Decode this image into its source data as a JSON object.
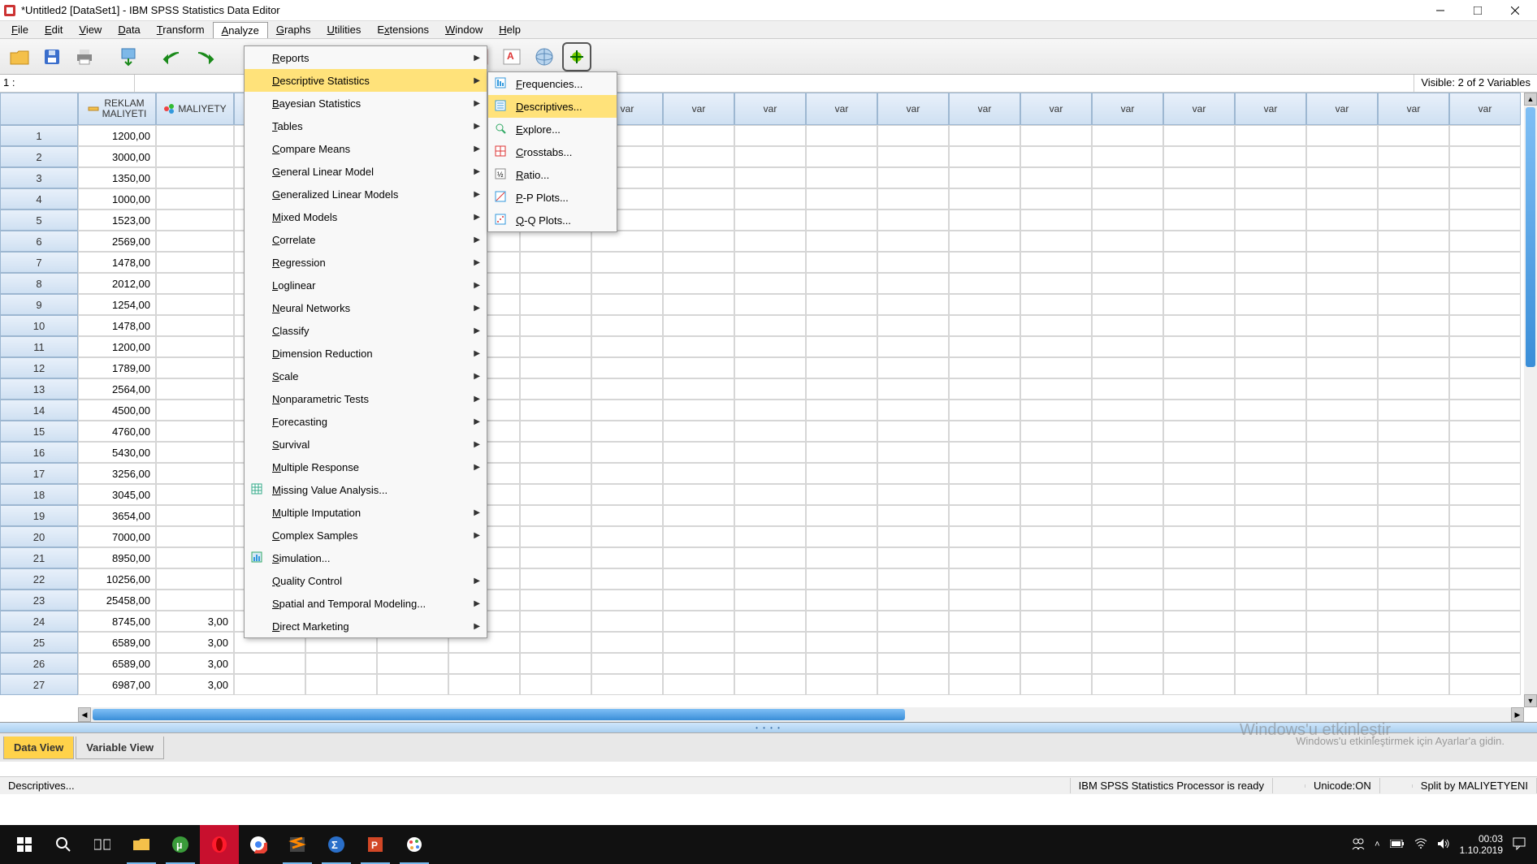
{
  "title": "*Untitled2 [DataSet1] - IBM SPSS Statistics Data Editor",
  "menubar": [
    "File",
    "Edit",
    "View",
    "Data",
    "Transform",
    "Analyze",
    "Graphs",
    "Utilities",
    "Extensions",
    "Window",
    "Help"
  ],
  "menubar_underline": [
    "F",
    "E",
    "V",
    "D",
    "T",
    "A",
    "G",
    "U",
    "x",
    "W",
    "H"
  ],
  "menubar_active": "Analyze",
  "cell_ref": "1 :",
  "visible_text": "Visible: 2 of 2 Variables",
  "columns_named": [
    {
      "label": "REKLAM MALIYETI",
      "icon": "ruler"
    },
    {
      "label": "MALIYETY",
      "icon": "balls"
    }
  ],
  "var_header": "var",
  "empty_var_cols": 18,
  "rows_shown": 27,
  "data_rows": [
    {
      "c1": "1200,00"
    },
    {
      "c1": "3000,00"
    },
    {
      "c1": "1350,00"
    },
    {
      "c1": "1000,00"
    },
    {
      "c1": "1523,00"
    },
    {
      "c1": "2569,00"
    },
    {
      "c1": "1478,00"
    },
    {
      "c1": "2012,00"
    },
    {
      "c1": "1254,00"
    },
    {
      "c1": "1478,00"
    },
    {
      "c1": "1200,00"
    },
    {
      "c1": "1789,00"
    },
    {
      "c1": "2564,00"
    },
    {
      "c1": "4500,00"
    },
    {
      "c1": "4760,00"
    },
    {
      "c1": "5430,00"
    },
    {
      "c1": "3256,00"
    },
    {
      "c1": "3045,00"
    },
    {
      "c1": "3654,00"
    },
    {
      "c1": "7000,00"
    },
    {
      "c1": "8950,00"
    },
    {
      "c1": "10256,00"
    },
    {
      "c1": "25458,00"
    },
    {
      "c1": "8745,00",
      "c2": "3,00"
    },
    {
      "c1": "6589,00",
      "c2": "3,00"
    },
    {
      "c1": "6589,00",
      "c2": "3,00"
    },
    {
      "c1": "6987,00",
      "c2": "3,00"
    }
  ],
  "analyze_menu": [
    {
      "label": "Reports",
      "arrow": true
    },
    {
      "label": "Descriptive Statistics",
      "arrow": true,
      "hl": true
    },
    {
      "label": "Bayesian Statistics",
      "arrow": true
    },
    {
      "label": "Tables",
      "arrow": true
    },
    {
      "label": "Compare Means",
      "arrow": true
    },
    {
      "label": "General Linear Model",
      "arrow": true
    },
    {
      "label": "Generalized Linear Models",
      "arrow": true
    },
    {
      "label": "Mixed Models",
      "arrow": true
    },
    {
      "label": "Correlate",
      "arrow": true
    },
    {
      "label": "Regression",
      "arrow": true
    },
    {
      "label": "Loglinear",
      "arrow": true
    },
    {
      "label": "Neural Networks",
      "arrow": true
    },
    {
      "label": "Classify",
      "arrow": true
    },
    {
      "label": "Dimension Reduction",
      "arrow": true
    },
    {
      "label": "Scale",
      "arrow": true
    },
    {
      "label": "Nonparametric Tests",
      "arrow": true
    },
    {
      "label": "Forecasting",
      "arrow": true
    },
    {
      "label": "Survival",
      "arrow": true
    },
    {
      "label": "Multiple Response",
      "arrow": true
    },
    {
      "label": "Missing Value Analysis...",
      "arrow": false,
      "icon": "grid"
    },
    {
      "label": "Multiple Imputation",
      "arrow": true
    },
    {
      "label": "Complex Samples",
      "arrow": true
    },
    {
      "label": "Simulation...",
      "arrow": false,
      "icon": "sim"
    },
    {
      "label": "Quality Control",
      "arrow": true
    },
    {
      "label": "Spatial and Temporal Modeling...",
      "arrow": true
    },
    {
      "label": "Direct Marketing",
      "arrow": true
    }
  ],
  "sub_menu": [
    {
      "label": "Frequencies...",
      "icon": "freq"
    },
    {
      "label": "Descriptives...",
      "icon": "desc",
      "hl": true
    },
    {
      "label": "Explore...",
      "icon": "explore"
    },
    {
      "label": "Crosstabs...",
      "icon": "cross"
    },
    {
      "label": "Ratio...",
      "icon": "ratio"
    },
    {
      "label": "P-P Plots...",
      "icon": "pp"
    },
    {
      "label": "Q-Q Plots...",
      "icon": "qq"
    }
  ],
  "tabs": {
    "data": "Data View",
    "variable": "Variable View",
    "active": "data"
  },
  "status": {
    "left": "Descriptives...",
    "proc": "IBM SPSS Statistics Processor is ready",
    "unicode": "Unicode:ON",
    "split": "Split by MALIYETYENI"
  },
  "watermark": {
    "head": "Windows'u etkinleştir",
    "sub": "Windows'u etkinleştirmek için Ayarlar'a gidin."
  },
  "clock": {
    "time": "00:03",
    "date": "1.10.2019"
  }
}
